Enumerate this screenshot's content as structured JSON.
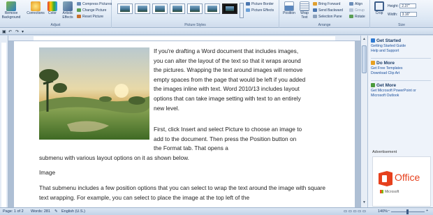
{
  "ribbon": {
    "adjust": {
      "remove_background": "Remove Background",
      "corrections": "Corrections",
      "color": "Color",
      "artistic_effects": "Artistic Effects",
      "compress_pictures": "Compress Pictures",
      "change_picture": "Change Picture",
      "reset_picture": "Reset Picture",
      "group_label": "Adjust"
    },
    "picture_styles": {
      "picture_border": "Picture Border",
      "picture_effects": "Picture Effects",
      "group_label": "Picture Styles"
    },
    "arrange": {
      "position": "Position",
      "wrap_text": "Wrap Text",
      "bring_forward": "Bring Forward",
      "send_backward": "Send Backward",
      "selection_pane": "Selection Pane",
      "align": "Align",
      "group": "Group",
      "rotate": "Rotate",
      "group_label": "Arrange"
    },
    "size": {
      "crop": "Crop",
      "height_label": "Height:",
      "height_value": "2.37\"",
      "width_label": "Width:",
      "width_value": "3.16\"",
      "group_label": "Size"
    }
  },
  "document": {
    "paragraph1": "If you're drafting a Word document that includes images, you can alter the layout of the text so that it wraps around the pictures. Wrapping the text around images will remove empty spaces from the page that would be left if you added the images inline with text. Word 2010/13 includes layout options that can take image setting with text to an entirely new level.",
    "paragraph2_wrapped": "First, click Insert and select Picture to choose an image to add to the document. Then press the Position button on the Format tab. That opens a",
    "paragraph2_full": "submenu with various layout options on it as shown below.",
    "image_caption": "Image",
    "paragraph3": "That submenu includes a few position options that you can select to wrap the text around the image with square text wrapping. For example, you can select to place the image at the top left of the"
  },
  "task_pane": {
    "get_started": {
      "title": "Get Started",
      "links": [
        "Getting Started Guide",
        "Help and Support"
      ]
    },
    "do_more": {
      "title": "Do More",
      "links": [
        "Get Free Templates",
        "Download Clip Art"
      ]
    },
    "get_more": {
      "title": "Get More",
      "links": [
        "Get Microsoft PowerPoint or Microsoft Outlook"
      ]
    },
    "advertisement_label": "Advertisement",
    "ad": {
      "product": "Office",
      "brand": "Microsoft"
    }
  },
  "status_bar": {
    "page": "Page: 1 of 2",
    "words": "Words: 281",
    "language": "English (U.S.)",
    "zoom": "140%"
  },
  "colors": {
    "ribbon_bg": "#dce7f4",
    "link": "#1a4f9c",
    "office_orange": "#e6401d"
  }
}
